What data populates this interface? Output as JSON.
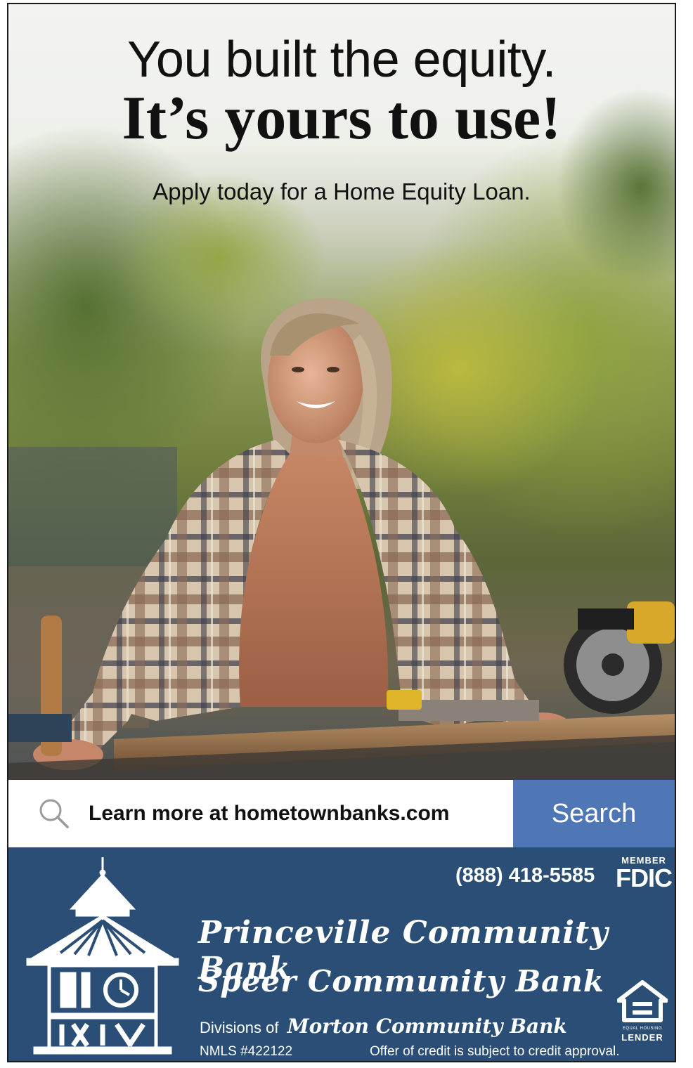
{
  "headline": {
    "line1": "You built the equity.",
    "line2": "It’s yours to use!",
    "sub": "Apply today for a Home Equity Loan."
  },
  "search": {
    "text": "Learn more at hometownbanks.com",
    "button_label": "Search",
    "icon": "search-icon"
  },
  "footer": {
    "phone": "(888) 418-5585",
    "fdic_member": "MEMBER",
    "fdic": "FDIC",
    "bank1": "Princeville Community Bank",
    "bank2": "Speer Community Bank",
    "divisions_prefix": "Divisions of",
    "parent_bank": "Morton Community Bank",
    "nmls": "NMLS #422122",
    "offer": "Offer of credit is subject to credit approval.",
    "ehl_small": "EQUAL HOUSING",
    "ehl_lender": "LENDER"
  },
  "colors": {
    "footer_bg": "#2a4e75",
    "search_button": "#4f77b5",
    "text_dark": "#111111"
  }
}
